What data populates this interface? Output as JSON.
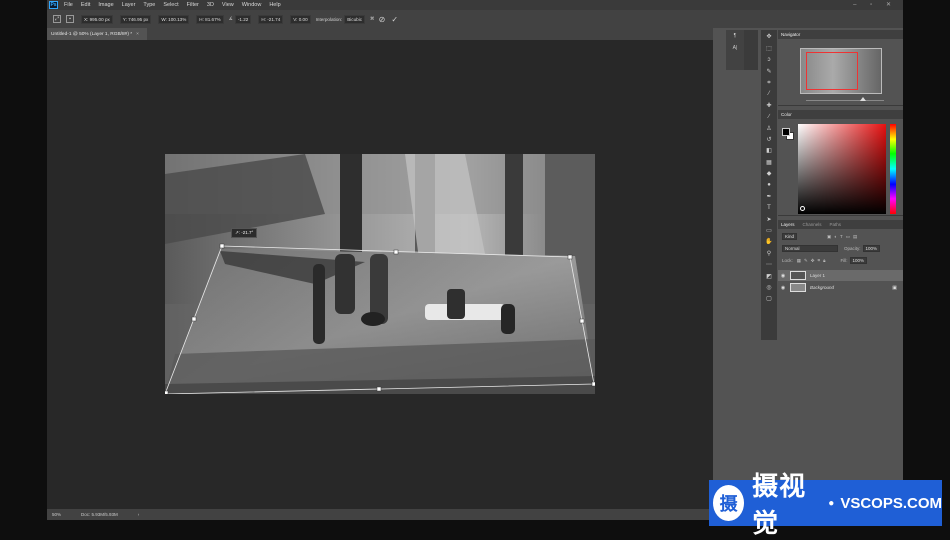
{
  "menu": {
    "logo": "Ps",
    "items": [
      "File",
      "Edit",
      "Image",
      "Layer",
      "Type",
      "Select",
      "Filter",
      "3D",
      "View",
      "Window",
      "Help"
    ],
    "win_controls": "– ▫ ✕"
  },
  "options": {
    "x": "X: 995.00 px",
    "y": "Y: 746.95 px",
    "w": "W: 100.13%",
    "h": "H: 81.67%",
    "angle": "-1.22",
    "hskew": "H: -21.74",
    "vskew": "V: 0.00",
    "interp_label": "Interpolation:",
    "interp_value": "Bicubic"
  },
  "doc_tab": {
    "title": "Untitled-1 @ 50% (Layer 1, RGB/8#) *",
    "close": "×"
  },
  "canvas": {
    "skew_readout": "↗: -21.7°"
  },
  "status": {
    "zoom": "50%",
    "doc": "Doc: 5.93M/5.93M",
    "arrow": "›"
  },
  "dock": {
    "items": [
      "¶",
      "A|"
    ]
  },
  "navigator": {
    "title": "Navigator"
  },
  "color": {
    "title": "Color"
  },
  "layers": {
    "tabs": [
      "Layers",
      "Channels",
      "Paths"
    ],
    "kind": "Kind",
    "blend": "Normal",
    "opacity_label": "Opacity:",
    "opacity": "100%",
    "lock_label": "Lock:",
    "fill_label": "Fill:",
    "fill": "100%",
    "items": [
      {
        "name": "Layer 1"
      },
      {
        "name": "Background"
      }
    ]
  },
  "watermark": {
    "logo": "摄",
    "cn": "摄视觉",
    "dot": "●",
    "en": "VSCOPS.COM"
  },
  "colors": {
    "app_bg": "#535353",
    "canvas_bg": "#282828",
    "watermark_blue": "#1f5fd6"
  }
}
